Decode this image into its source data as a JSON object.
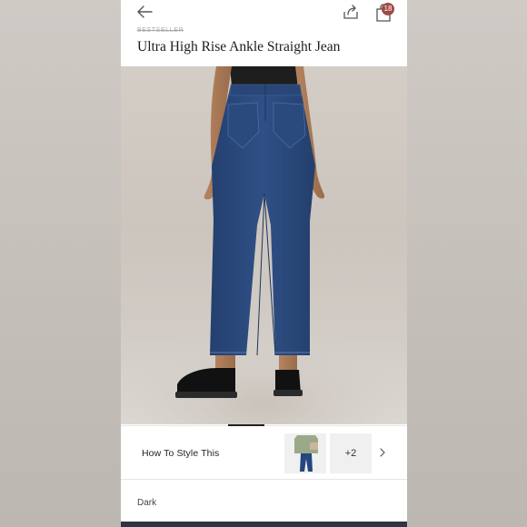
{
  "product": {
    "badge": "BESTSELLER",
    "title": "Ultra High Rise Ankle Straight Jean"
  },
  "header": {
    "bag_count": "18"
  },
  "style_section": {
    "label": "How To Style This",
    "more_count": "+2"
  },
  "variant": {
    "color": "Dark"
  },
  "colors": {
    "badge": "#a14a45",
    "denim": "#2f4f86",
    "text": "#1c1c1c"
  }
}
